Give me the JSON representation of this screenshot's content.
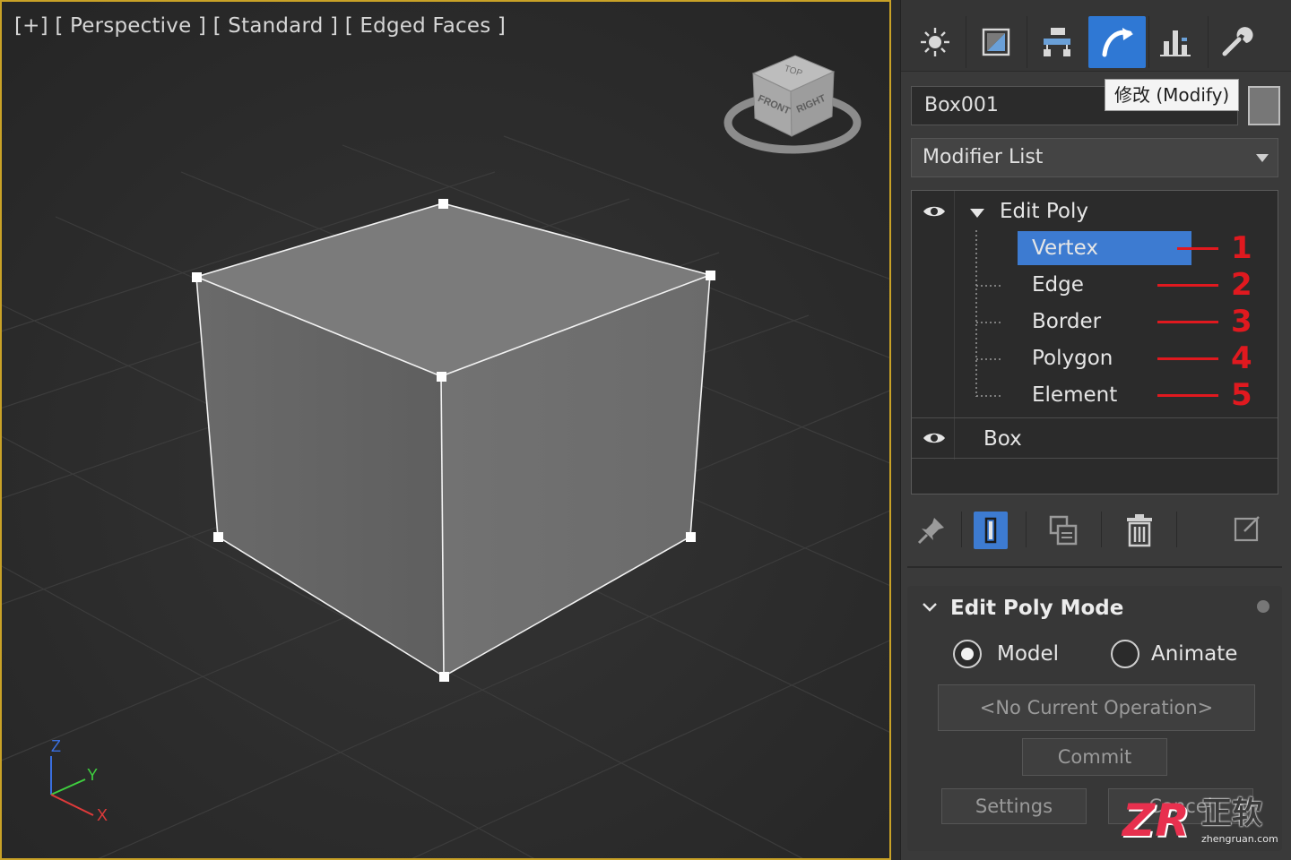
{
  "viewport": {
    "label": "[+] [ Perspective ] [ Standard ] [ Edged Faces ]",
    "viewcube": {
      "top": "TOP",
      "front": "FRONT",
      "right": "RIGHT"
    },
    "axes": {
      "z": "Z",
      "y": "Y",
      "x": "X"
    }
  },
  "command_panel": {
    "tabs": [
      {
        "name": "create-tab",
        "icon": "sun-icon"
      },
      {
        "name": "display-tab",
        "icon": "display-icon"
      },
      {
        "name": "hierarchy-tab",
        "icon": "hierarchy-icon"
      },
      {
        "name": "modify-tab",
        "icon": "modify-arc-icon",
        "active": true
      },
      {
        "name": "motion-tab",
        "icon": "motion-icon"
      },
      {
        "name": "utilities-tab",
        "icon": "wrench-icon"
      }
    ],
    "tooltip": "修改 (Modify)",
    "object_name": "Box001",
    "object_color": "#777777",
    "modifier_list_label": "Modifier List",
    "stack": {
      "edit_poly_label": "Edit Poly",
      "sub_objects": [
        {
          "label": "Vertex",
          "number": "1",
          "selected": true
        },
        {
          "label": "Edge",
          "number": "2"
        },
        {
          "label": "Border",
          "number": "3"
        },
        {
          "label": "Polygon",
          "number": "4"
        },
        {
          "label": "Element",
          "number": "5"
        }
      ],
      "base_label": "Box"
    },
    "rollout": {
      "title": "Edit Poly Mode",
      "radio_model": "Model",
      "radio_animate": "Animate",
      "operation_button": "<No Current Operation>",
      "commit_button": "Commit",
      "settings_button": "Settings",
      "cancel_button": "Cancel"
    }
  },
  "watermark": {
    "logo": "ZR",
    "text": "正软",
    "url": "zhengruan.com"
  },
  "colors": {
    "accent": "#2f78d4",
    "selection": "#3d7bd1",
    "annotation_red": "#e0191f",
    "viewport_border": "#c9a227"
  }
}
